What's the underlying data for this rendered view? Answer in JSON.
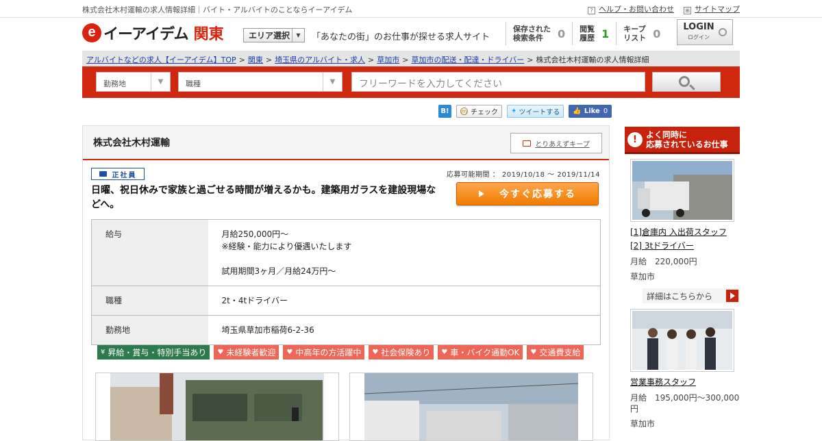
{
  "header": {
    "tagline": "株式会社木村運輸の求人情報詳細｜バイト・アルバイトのことならイーアイデム",
    "help_link": "ヘルプ・お問い合わせ",
    "sitemap_link": "サイトマップ",
    "logo_mark": "e",
    "brand": "イーアイデム",
    "region": "関東",
    "area_select": "エリア選択",
    "slogan": "「あなたの街」のお仕事が探せる求人サイト",
    "counters": [
      {
        "label1": "保存された",
        "label2": "検索条件",
        "count": "0"
      },
      {
        "label1": "閲覧",
        "label2": "履歴",
        "count": "1"
      },
      {
        "label1": "キープ",
        "label2": "リスト",
        "count": "0"
      }
    ],
    "login_main": "LOGIN",
    "login_sub": "ログイン"
  },
  "breadcrumb": {
    "items": [
      "アルバイトなどの求人【イーアイデム】TOP",
      "関東",
      "埼玉県のアルバイト・求人",
      "草加市",
      "草加市の配送・配達・ドライバー"
    ],
    "current": "株式会社木村運輸の求人情報詳細"
  },
  "search": {
    "location_placeholder": "勤務地",
    "jobtype_placeholder": "職種",
    "freeword_placeholder": "フリーワードを入力してください"
  },
  "social": {
    "hatena": "B!",
    "mixi": "チェック",
    "tweet": "ツイートする",
    "fb_like": "Like",
    "fb_count": "0"
  },
  "job": {
    "company": "株式会社木村運輸",
    "keep_button": "とりあえずキープ",
    "employment_type": "正社員",
    "period": "応募可能期間 ： 2019/10/18 ～ 2019/11/14",
    "headline": "日曜、祝日休みで家族と過ごせる時間が増えるかも。建築用ガラスを建設現場などへ。",
    "apply_button": "今すぐ応募する",
    "salary_label": "給与",
    "salary_line1": "月給250,000円〜",
    "salary_line2": "※経験・能力により優遇いたします",
    "salary_line3": "試用期間3ヶ月／月給24万円〜",
    "jobtype_label": "職種",
    "jobtype_value": "2t・4tドライバー",
    "location_label": "勤務地",
    "location_value": "埼玉県草加市稲荷6-2-36",
    "tags": [
      "昇給・賞与・特別手当あり",
      "未経験者歓迎",
      "中高年の方活躍中",
      "社会保険あり",
      "車・バイク通勤OK",
      "交通費支給"
    ]
  },
  "sidebar": {
    "heading1": "よく同時に",
    "heading2": "応募されているお仕事",
    "jobs": [
      {
        "title1": "[1]倉庫内 入出荷スタッフ",
        "title2": "[2] 3tドライバー",
        "pay": "月給　220,000円",
        "location": "草加市",
        "detail": "詳細はこちらから"
      },
      {
        "title1": "営業事務スタッフ",
        "pay": "月給　195,000円～300,000円",
        "location": "草加市"
      }
    ]
  },
  "colors": {
    "brand_red": "#d0280e",
    "apply_orange": "#f07c00",
    "tag_pink": "#f06656",
    "tag_green": "#2d7a4d"
  }
}
